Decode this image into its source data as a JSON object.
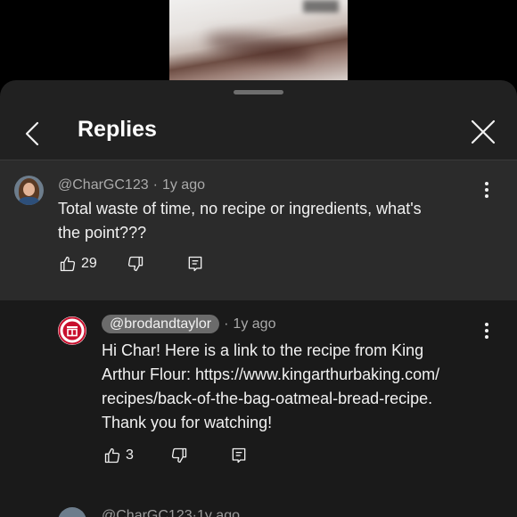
{
  "header": {
    "title": "Replies"
  },
  "parent_comment": {
    "author": "@CharGC123",
    "time": "1y ago",
    "text_line1": "Total waste of time, no recipe or ingredients, what's",
    "text_line2": "the point???",
    "likes": "29"
  },
  "reply": {
    "author": "@brodandtaylor",
    "time": "1y ago",
    "lines": [
      "Hi Char! Here is a link to the recipe from King",
      "Arthur Flour: https://www.kingarthurbaking.com/",
      "recipes/back-of-the-bag-oatmeal-bread-recipe.",
      "Thank you for watching!"
    ],
    "likes": "3"
  },
  "next_reply": {
    "author": "@CharGC123",
    "time": "1y ago"
  },
  "separator": "·",
  "colors": {
    "sheet": "#212121",
    "highlight": "#2b2b2b",
    "replies_bg": "#1a1a1a",
    "brand_red": "#c8102e"
  },
  "icons": [
    "back-icon",
    "close-icon",
    "more-vert-icon",
    "thumb-up-icon",
    "thumb-down-icon",
    "comment-reply-icon"
  ]
}
